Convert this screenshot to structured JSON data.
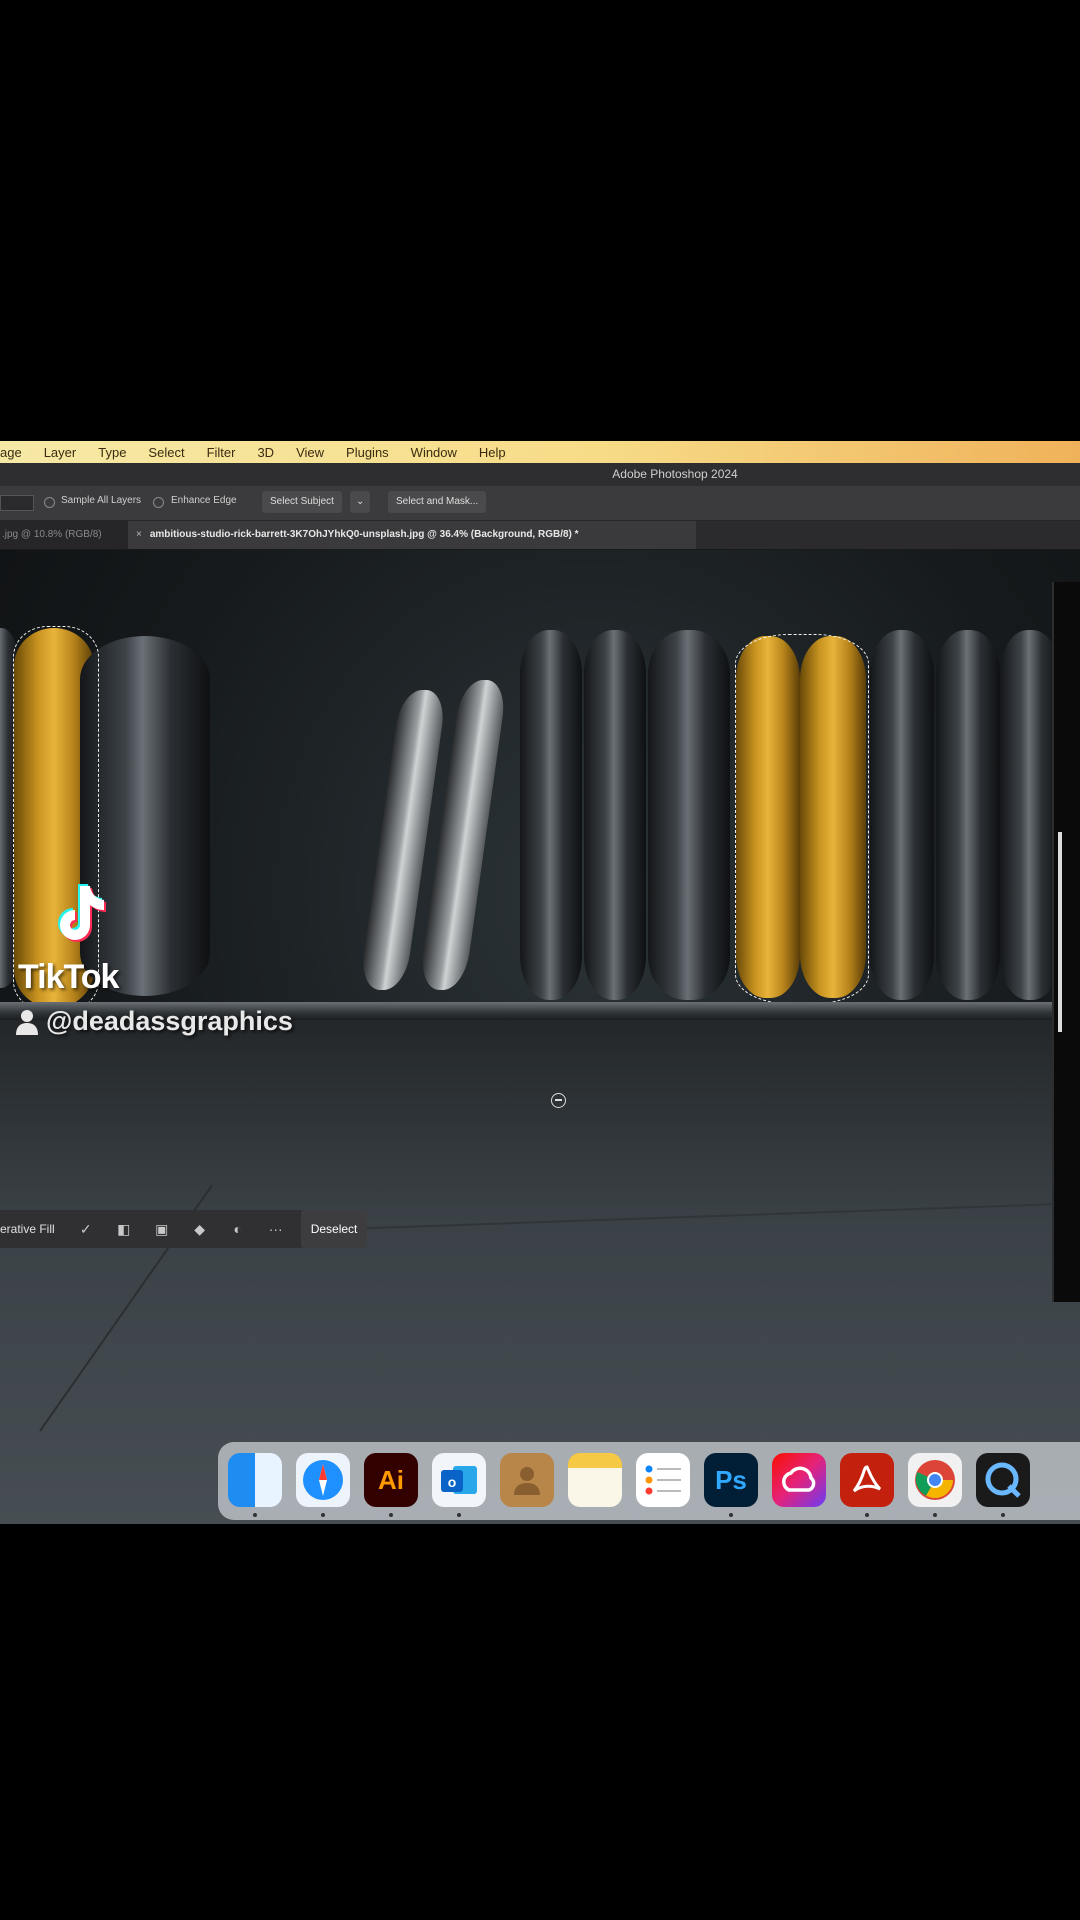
{
  "menubar": {
    "items": [
      "age",
      "Layer",
      "Type",
      "Select",
      "Filter",
      "3D",
      "View",
      "Plugins",
      "Window",
      "Help"
    ]
  },
  "window": {
    "title": "Adobe Photoshop 2024"
  },
  "options_bar": {
    "sample_all_layers": "Sample All Layers",
    "enhance_edge": "Enhance Edge",
    "select_subject": "Select Subject",
    "select_and_mask": "Select and Mask..."
  },
  "tabs": {
    "inactive": ".jpg @ 10.8% (RGB/8)",
    "active": "ambitious-studio-rick-barrett-3K7OhJYhkQ0-unsplash.jpg @ 36.4% (Background, RGB/8) *",
    "close_glyph": "×"
  },
  "contextual_taskbar": {
    "generative_fill": "erative Fill",
    "deselect": "Deselect",
    "more": "···"
  },
  "overlay": {
    "brand": "TikTok",
    "username": "@deadassgraphics"
  },
  "dock": {
    "apps": [
      {
        "name": "Finder",
        "icon": "finder-icon",
        "label": "",
        "color": "#2a8df5"
      },
      {
        "name": "Safari",
        "icon": "safari-icon",
        "label": "",
        "color": "#1e90ff"
      },
      {
        "name": "Illustrator",
        "icon": "illustrator-icon",
        "label": "Ai",
        "color": "#330000"
      },
      {
        "name": "Outlook",
        "icon": "outlook-icon",
        "label": "",
        "color": "#0a64c8"
      },
      {
        "name": "Contacts",
        "icon": "contacts-icon",
        "label": "",
        "color": "#b9864a"
      },
      {
        "name": "Notes",
        "icon": "notes-icon",
        "label": "",
        "color": "#f6c945"
      },
      {
        "name": "Reminders",
        "icon": "reminders-icon",
        "label": "",
        "color": "#ffffff"
      },
      {
        "name": "Photoshop",
        "icon": "photoshop-icon",
        "label": "Ps",
        "color": "#001e36"
      },
      {
        "name": "Creative Cloud",
        "icon": "creative-cloud-icon",
        "label": "",
        "color": "#da1f26"
      },
      {
        "name": "Acrobat",
        "icon": "acrobat-icon",
        "label": "",
        "color": "#c4200e"
      },
      {
        "name": "Chrome",
        "icon": "chrome-icon",
        "label": "",
        "color": "#ffffff"
      },
      {
        "name": "QuickTime",
        "icon": "quicktime-icon",
        "label": "",
        "color": "#1a1a1a"
      }
    ]
  }
}
